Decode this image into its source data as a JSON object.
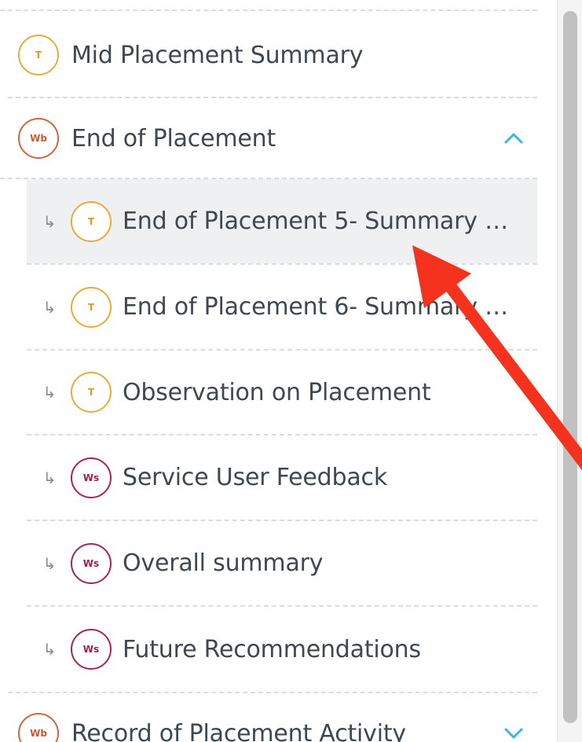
{
  "nav": {
    "mid_placement": {
      "badge": "T",
      "label": "Mid Placement Summary"
    },
    "end_of_placement": {
      "badge": "Wb",
      "label": "End of Placement",
      "expanded": true,
      "children": [
        {
          "badge": "T",
          "label": "End of Placement 5- Summary of ...",
          "selected": true
        },
        {
          "badge": "T",
          "label": "End of Placement 6- Summary of ..."
        },
        {
          "badge": "T",
          "label": "Observation on Placement"
        },
        {
          "badge": "Ws",
          "label": "Service User Feedback"
        },
        {
          "badge": "Ws",
          "label": "Overall summary"
        },
        {
          "badge": "Ws",
          "label": "Future Recommendations"
        }
      ]
    },
    "record_activity": {
      "badge": "Wb",
      "label": "Record of Placement Activity",
      "expanded": false
    }
  },
  "icons": {
    "child_indent": "↳",
    "expanded": "chevron-up-icon",
    "collapsed": "chevron-down-icon"
  },
  "colors": {
    "task_badge": "#e6ac3c",
    "workbook_badge": "#d2663c",
    "worksheet_badge": "#a3265a",
    "chevron": "#38b6e0",
    "selected_row": "#eef0f1",
    "annotation_arrow": "#f4321e"
  }
}
